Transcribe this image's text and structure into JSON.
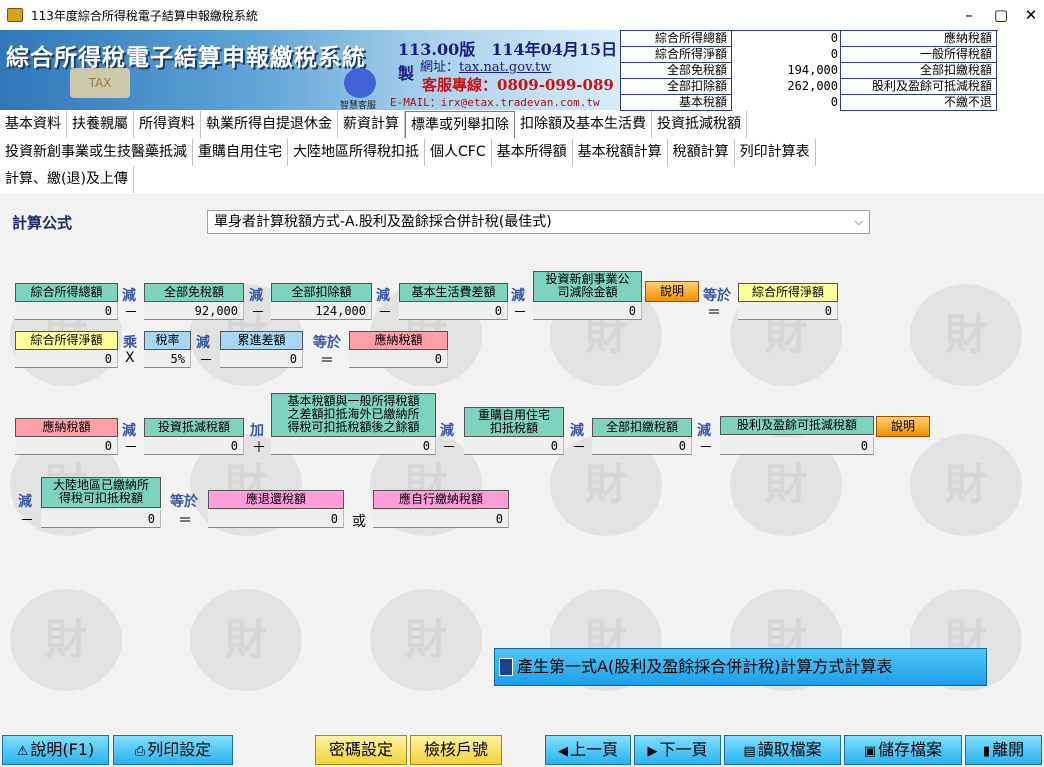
{
  "window": {
    "title": "113年度綜合所得稅電子結算申報繳稅系統",
    "minimize": "–",
    "maximize": "▢",
    "close": "✕"
  },
  "banner": {
    "title": "綜合所得稅電子結算申報繳稅系統",
    "version": "113.00版　114年04月15日製",
    "site_label": "網址：",
    "site_url": "tax.nat.gov.tw",
    "hotline": "客服專線：0809-099-089",
    "email": "E-MAIL：irx@etax.tradevan.com.tw",
    "tax_badge": "TAX",
    "service_label": "智慧客服"
  },
  "summary": {
    "rows": [
      {
        "label": "綜合所得總額",
        "value": "0",
        "right_label": "應納稅額"
      },
      {
        "label": "綜合所得淨額",
        "value": "0",
        "right_label": "一般所得稅額"
      },
      {
        "label": "全部免稅額",
        "value": "194,000",
        "right_label": "全部扣繳稅額"
      },
      {
        "label": "全部扣除額",
        "value": "262,000",
        "right_label": "股利及盈餘可抵減稅額"
      },
      {
        "label": "基本稅額",
        "value": "0",
        "right_label": "不繳不退"
      }
    ]
  },
  "tabs": {
    "row1": [
      "基本資料",
      "扶養親屬",
      "所得資料",
      "執業所得自提退休金",
      "薪資計算",
      "標準或列舉扣除",
      "扣除額及基本生活費",
      "投資抵減稅額"
    ],
    "row2": [
      "投資新創事業或生技醫藥抵減",
      "重購自用住宅",
      "大陸地區所得稅扣抵",
      "個人CFC",
      "基本所得額",
      "基本稅額計算",
      "稅額計算",
      "列印計算表"
    ],
    "row3": [
      "計算、繳(退)及上傳"
    ],
    "active": "標準或列舉扣除"
  },
  "formula": {
    "label": "計算公式",
    "selected": "單身者計算稅額方式-A.股利及盈餘採合併計稅(最佳式)"
  },
  "ops": {
    "minus": "減",
    "minus_sign": "－",
    "plus": "加",
    "plus_sign": "＋",
    "times": "乘",
    "times_sign": "X",
    "equals": "等於",
    "equals_sign": "＝",
    "or": "或"
  },
  "row1": {
    "gross_income": {
      "label": "綜合所得總額",
      "value": "0"
    },
    "exemption": {
      "label": "全部免稅額",
      "value": "92,000"
    },
    "deduction": {
      "label": "全部扣除額",
      "value": "124,000"
    },
    "basic_living": {
      "label": "基本生活費差額",
      "value": "0"
    },
    "startup_deduction": {
      "label": "投資新創事業公\n司減除金額",
      "value": "0"
    },
    "explain": "說明",
    "net_income": {
      "label": "綜合所得淨額",
      "value": "0"
    }
  },
  "row2": {
    "net_income": {
      "label": "綜合所得淨額",
      "value": "0"
    },
    "rate": {
      "label": "稅率",
      "value": "5%"
    },
    "progressive": {
      "label": "累進差額",
      "value": "0"
    },
    "tax_payable": {
      "label": "應納稅額",
      "value": "0"
    }
  },
  "row3": {
    "tax_payable": {
      "label": "應納稅額",
      "value": "0"
    },
    "investment_credit": {
      "label": "投資抵減稅額",
      "value": "0"
    },
    "basic_tax_diff": {
      "label": "基本稅額與一般所得稅額\n之差額扣抵海外已繳納所\n得稅可扣抵稅額後之餘額",
      "value": "0"
    },
    "rebuy_house": {
      "label": "重購自用住宅\n扣抵稅額",
      "value": "0"
    },
    "withholding": {
      "label": "全部扣繳稅額",
      "value": "0"
    },
    "dividend_credit": {
      "label": "股利及盈餘可抵減稅額",
      "value": "0"
    },
    "explain": "說明"
  },
  "row4": {
    "mainland_credit": {
      "label": "大陸地區已繳納所\n得稅可扣抵稅額",
      "value": "0"
    },
    "refund": {
      "label": "應退還稅額",
      "value": "0"
    },
    "self_pay": {
      "label": "應自行繳納稅額",
      "value": "0"
    }
  },
  "generate_button": "產生第一式A(股利及盈餘採合併計稅)計算方式計算表",
  "watermark_char": "財",
  "bottom": {
    "help": "說明(F1)",
    "print_setup": "列印設定",
    "password": "密碼設定",
    "check_id": "檢核戶號",
    "prev": "上一頁",
    "next": "下一頁",
    "read_file": "讀取檔案",
    "save_file": "儲存檔案",
    "exit": "離開"
  },
  "colors": {
    "label_green": "#7ed3be",
    "label_yellow": "#ffff99",
    "label_blue": "#a8d7f5",
    "label_red": "#ffa0a8",
    "label_pink": "#ff9ed8",
    "operator_blue": "#3b57a8",
    "button_cyan": "#2ab2ee",
    "button_yellow": "#f2d23a"
  }
}
